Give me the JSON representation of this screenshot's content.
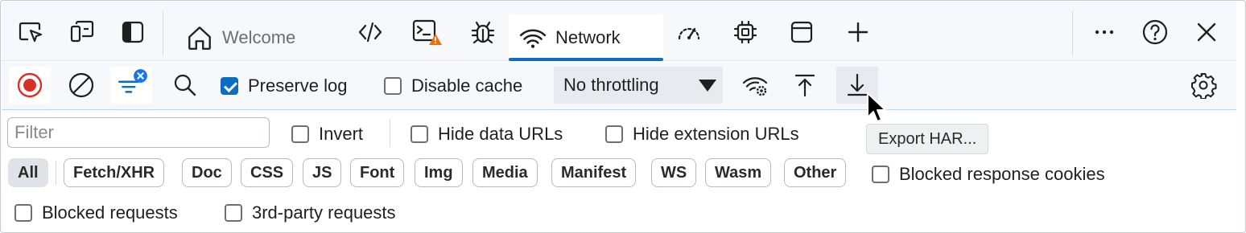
{
  "tabs": [
    {
      "label": "Welcome",
      "icon": "home-icon",
      "active": false
    },
    {
      "label": "",
      "icon": "elements-code-icon",
      "active": false
    },
    {
      "label": "",
      "icon": "console-icon",
      "active": false,
      "badge": "warning"
    },
    {
      "label": "",
      "icon": "bug-icon",
      "active": false
    },
    {
      "label": "Network",
      "icon": "wifi-icon",
      "active": true
    },
    {
      "label": "",
      "icon": "performance-gauge-icon",
      "active": false
    },
    {
      "label": "",
      "icon": "memory-chip-icon",
      "active": false
    },
    {
      "label": "",
      "icon": "application-icon",
      "active": false
    }
  ],
  "toolbar": {
    "preserve_log": {
      "label": "Preserve log",
      "checked": true
    },
    "disable_cache": {
      "label": "Disable cache",
      "checked": false
    },
    "throttling": {
      "value": "No throttling"
    },
    "tooltip": "Export HAR..."
  },
  "filter": {
    "placeholder": "Filter",
    "value": "",
    "invert": {
      "label": "Invert",
      "checked": false
    },
    "hide_data_urls": {
      "label": "Hide data URLs",
      "checked": false
    },
    "hide_extension_urls": {
      "label": "Hide extension URLs",
      "checked": false
    },
    "types": [
      "All",
      "Fetch/XHR",
      "Doc",
      "CSS",
      "JS",
      "Font",
      "Img",
      "Media",
      "Manifest",
      "WS",
      "Wasm",
      "Other"
    ],
    "selected_type": "All",
    "blocked_response_cookies": {
      "label": "Blocked response cookies",
      "checked": false
    },
    "blocked_requests": {
      "label": "Blocked requests",
      "checked": false
    },
    "third_party_requests": {
      "label": "3rd-party requests",
      "checked": false
    }
  },
  "colors": {
    "accent": "#0b6cc1",
    "record_red": "#d93025",
    "warning_orange": "#e8710a",
    "filter_badge_blue": "#1a73e8"
  }
}
